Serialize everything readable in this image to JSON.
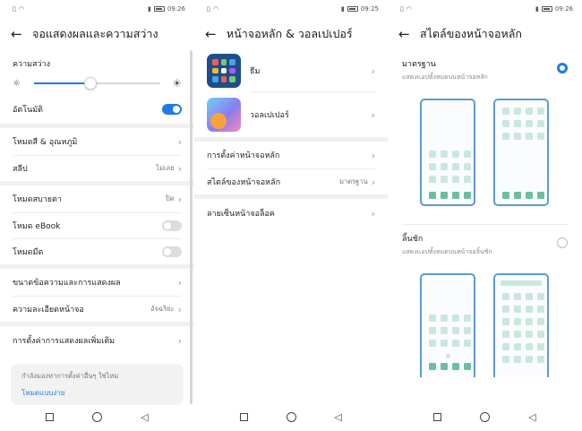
{
  "status": {
    "p1_time": "09:26",
    "p2_time": "09:25",
    "p3_time": "09:26"
  },
  "display": {
    "title": "จอแสดงผลและความสว่าง",
    "brightness_label": "ความสว่าง",
    "brightness_level": 0.45,
    "auto_label": "อัตโนมัติ",
    "auto_on": true,
    "color_mode": "โหมดสี & อุณหภูมิ",
    "sleep": "สลีป",
    "sleep_value": "ไม่เลย",
    "eye_comfort": "โหมดสบายตา",
    "eye_comfort_value": "ปิด",
    "ebook": "โหมด eBook",
    "dark_mode": "โหมดมืด",
    "text_size": "ขนาดข้อความและการแสดงผล",
    "resolution": "ความละเอียดหน้าจอ",
    "resolution_value": "อัจฉริยะ",
    "more_settings": "การตั้งค่าการแสดงผลเพิ่มเติม",
    "hint_text": "กำลังมองหาการตั้งค่าอื่นๆ ใช่ไหม",
    "hint_link": "โหมดแบบง่าย"
  },
  "homescreen": {
    "title": "หน้าจอหลัก & วอลเปเปอร์",
    "themes": "ธีม",
    "wallpaper": "วอลเปเปอร์",
    "settings": "การตั้งค่าหน้าจอหลัก",
    "style": "สไตล์ของหน้าจอหลัก",
    "style_value": "มาตรฐาน",
    "lock_signature": "ลายเซ็นหน้าจอล็อค"
  },
  "style": {
    "title": "สไตล์ของหน้าจอหลัก",
    "standard_label": "มาตรฐาน",
    "standard_desc": "แสดงแอปทั้งหมดบนหน้าจอหลัก",
    "drawer_label": "ลิ้นชัก",
    "drawer_desc": "แสดงแอปทั้งหมดบนหน้าจอลิ้นชัก",
    "selected": "standard"
  },
  "colors": {
    "accent": "#1d7ce6",
    "phone_frame": "#5b9bd5",
    "icon_tile": "#c9e8dc",
    "dock_tile": "#6bbf9e"
  }
}
